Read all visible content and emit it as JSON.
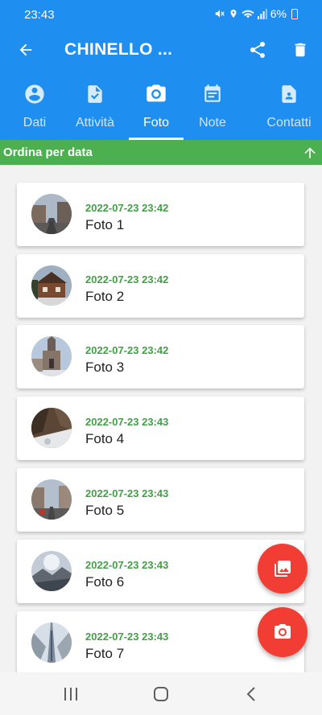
{
  "status_bar": {
    "time": "23:43",
    "battery": "6%"
  },
  "header": {
    "title": "CHINELLO ..."
  },
  "tabs": [
    {
      "label": "Dati",
      "icon": "account-circle-icon"
    },
    {
      "label": "Attività",
      "icon": "task-file-icon"
    },
    {
      "label": "Foto",
      "icon": "camera-icon"
    },
    {
      "label": "Note",
      "icon": "calendar-note-icon"
    },
    {
      "label": "Contatti",
      "icon": "contact-file-icon"
    }
  ],
  "active_tab": "Foto",
  "sort": {
    "label": "Ordina per data"
  },
  "photos": [
    {
      "date": "2022-07-23 23:42",
      "title": "Foto 1"
    },
    {
      "date": "2022-07-23 23:42",
      "title": "Foto 2"
    },
    {
      "date": "2022-07-23 23:42",
      "title": "Foto 3"
    },
    {
      "date": "2022-07-23 23:43",
      "title": "Foto 4"
    },
    {
      "date": "2022-07-23 23:43",
      "title": "Foto 5"
    },
    {
      "date": "2022-07-23 23:43",
      "title": "Foto 6"
    },
    {
      "date": "2022-07-23 23:43",
      "title": "Foto 7"
    }
  ],
  "colors": {
    "app_bar": "#1f8ef1",
    "sort_bar": "#4caf50",
    "date_text": "#43a047",
    "fab": "#f23d35"
  }
}
